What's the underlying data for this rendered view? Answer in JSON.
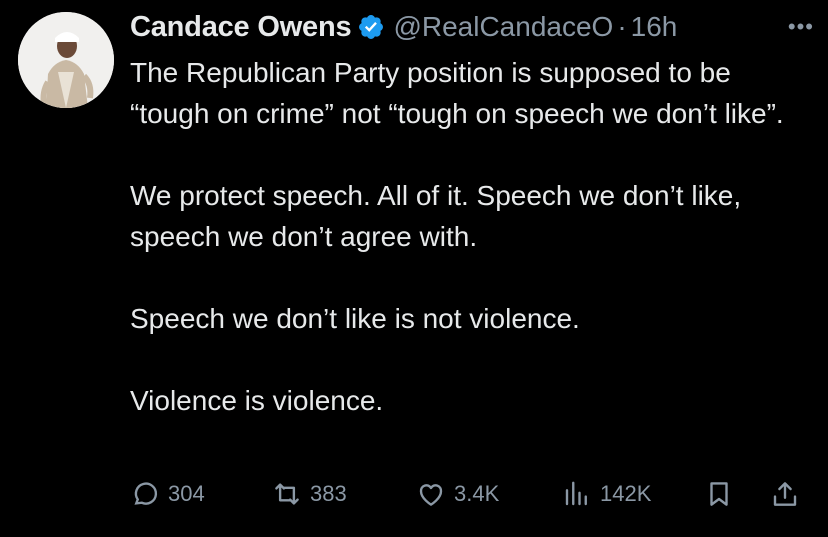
{
  "tweet": {
    "author_name": "Candace Owens",
    "handle": "@RealCandaceO",
    "separator": "·",
    "time": "16h",
    "paragraphs": [
      "The Republican Party position is supposed to be “tough on crime” not “tough on speech we don’t like”.",
      "We protect speech. All of it. Speech we don’t like, speech we don’t agree with.",
      "Speech we don’t like is not violence.",
      "Violence is violence."
    ]
  },
  "actions": {
    "replies": "304",
    "reposts": "383",
    "likes": "3.4K",
    "views": "142K"
  },
  "icons": [
    "verified-badge-icon",
    "more-icon",
    "reply-icon",
    "repost-icon",
    "like-icon",
    "views-icon",
    "bookmark-icon",
    "share-icon"
  ],
  "colors": {
    "background": "#000000",
    "text": "#e7e9ea",
    "muted": "#8b98a5",
    "verified": "#1d9bf0"
  }
}
